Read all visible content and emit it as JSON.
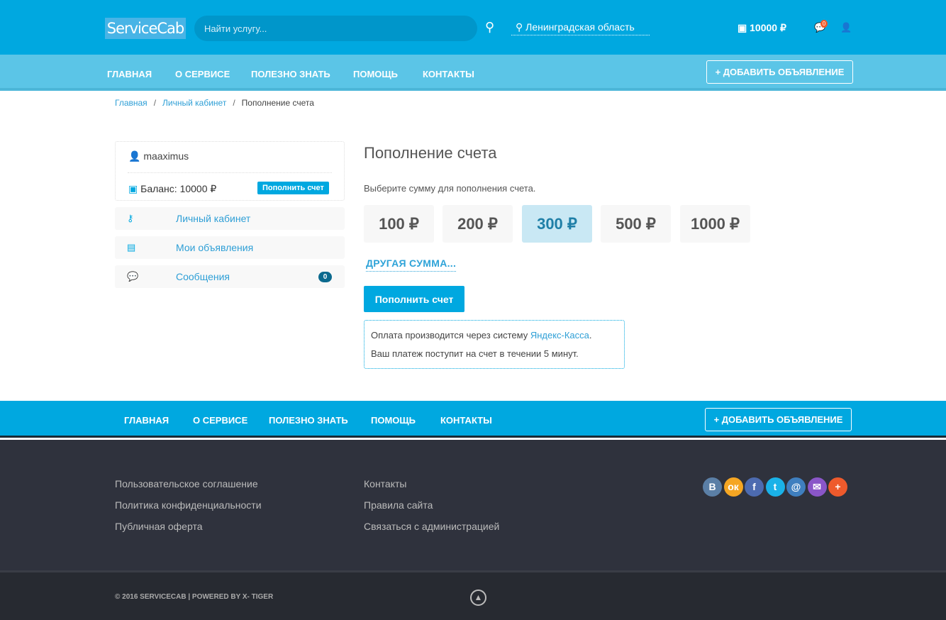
{
  "header": {
    "logo": "ServiceCab",
    "search_placeholder": "Найти услугу...",
    "region": "Ленинградская область",
    "balance": "10000 ₽",
    "messages_count": "0"
  },
  "nav": {
    "items": [
      "ГЛАВНАЯ",
      "О СЕРВИСЕ",
      "ПОЛЕЗНО ЗНАТЬ",
      "ПОМОЩЬ",
      "КОНТАКТЫ"
    ],
    "add_label": "+ ДОБАВИТЬ ОБЪЯВЛЕНИЕ"
  },
  "breadcrumb": [
    "Главная",
    "Личный кабинет",
    "Пополнение счета"
  ],
  "sidebar": {
    "username": "maaximus",
    "balance": "Баланс: 10000 ₽",
    "topup_label": "Пополнить счет",
    "items": [
      {
        "label": "Личный кабинет"
      },
      {
        "label": "Мои объявления"
      },
      {
        "label": "Сообщения",
        "badge": "0"
      }
    ]
  },
  "main": {
    "title": "Пополнение счета",
    "subtitle": "Выберите сумму для пополнения счета.",
    "amounts": [
      "100 ₽",
      "200 ₽",
      "300 ₽",
      "500 ₽",
      "1000 ₽"
    ],
    "selected_amount": "300 ₽",
    "other": "ДРУГАЯ СУММА...",
    "submit": "Пополнить счет",
    "info_prefix": "Оплата производится через систему ",
    "info_link": "Яндекс-Касса",
    "info_suffix": ".",
    "info_line2": "Ваш платеж поступит на счет в течении 5 минут."
  },
  "footer": {
    "col1": [
      "Пользовательское соглашение",
      "Политика конфиденциальности",
      "Публичная оферта"
    ],
    "col2": [
      "Контакты",
      "Правила сайта",
      "Связаться с администрацией"
    ],
    "social": [
      {
        "name": "vk",
        "glyph": "В",
        "color": "#5b7fa6"
      },
      {
        "name": "odnoklassniki",
        "glyph": "ок",
        "color": "#f5a623"
      },
      {
        "name": "facebook",
        "glyph": "f",
        "color": "#4d6bb0"
      },
      {
        "name": "twitter",
        "glyph": "t",
        "color": "#1ab2e8"
      },
      {
        "name": "mail",
        "glyph": "@",
        "color": "#3f7fbf"
      },
      {
        "name": "email",
        "glyph": "✉",
        "color": "#8a56c8"
      },
      {
        "name": "more",
        "glyph": "+",
        "color": "#ee5a2c"
      }
    ],
    "copyright": "© 2016 SERVICECAB | POWERED BY X- TIGER"
  }
}
